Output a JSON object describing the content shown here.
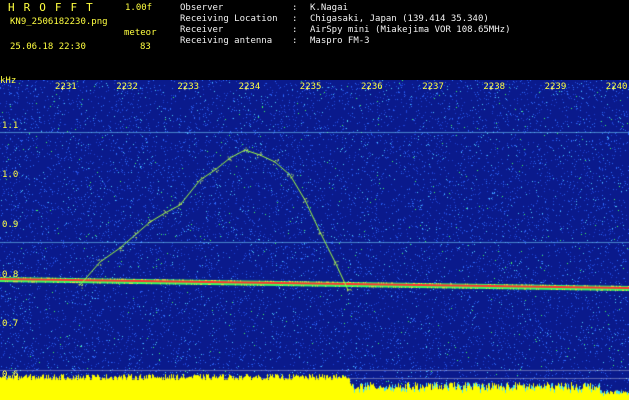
{
  "header": {
    "app_name": "HROFFT",
    "version": "1.00f",
    "filename": "KN9_2506182230.png",
    "meteor_label": "meteor",
    "datetime": "25.06.18 22:30",
    "meteor_count": "83"
  },
  "station": [
    {
      "key": "Observer",
      "sep": ":",
      "value": "K.Nagai"
    },
    {
      "key": "Receiving Location",
      "sep": ":",
      "value": "Chigasaki, Japan (139.414 35.340)"
    },
    {
      "key": "Receiver",
      "sep": ":",
      "value": "AirSpy mini (Miakejima VOR 108.65MHz)"
    },
    {
      "key": "Receiving antenna",
      "sep": ":",
      "value": "Maspro FM-3"
    }
  ],
  "spectrogram": {
    "y_unit": "kHz",
    "y_ticks": [
      "1.1",
      "1.0",
      "0.9",
      "0.8",
      "0.7",
      "0.6"
    ],
    "x_ticks": [
      "2231",
      "2232",
      "2233",
      "2234",
      "2235",
      "2236",
      "2237",
      "2238",
      "2239",
      "2240"
    ],
    "colors": {
      "background": "#0a1a8c",
      "noise": "#2f6cff",
      "hot": "#ff3030",
      "warm": "#40ff60",
      "trace": "#a0ff40",
      "floor": "#ffff00"
    }
  }
}
